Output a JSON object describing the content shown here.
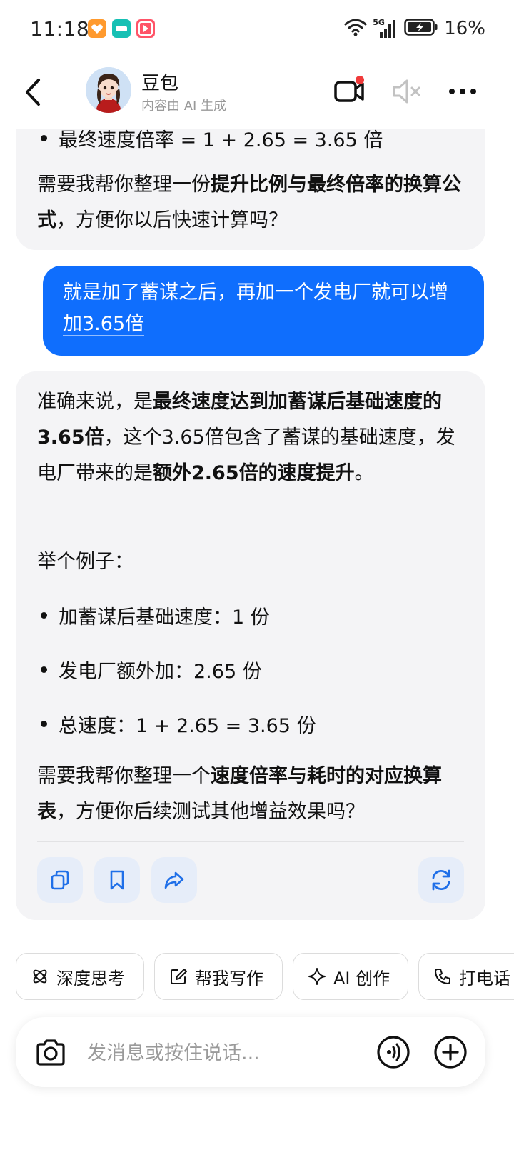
{
  "status": {
    "time": "11:18",
    "network": "5G",
    "battery": "16%"
  },
  "header": {
    "bot_name": "豆包",
    "subtitle": "内容由 AI 生成"
  },
  "messages": {
    "prev_bullet": "最终速度倍率 = 1 + 2.65 = 3.65 倍",
    "prev_question_a": "需要我帮你整理一份",
    "prev_question_b": "提升比例与最终倍率的换算公式",
    "prev_question_c": "，方便你以后快速计算吗？",
    "user": "就是加了蓄谋之后，再加一个发电厂就可以增加3.65倍",
    "reply_p1_a": "准确来说，是",
    "reply_p1_b": "最终速度达到加蓄谋后基础速度的3.65倍",
    "reply_p1_c": "，这个3.65倍包含了蓄谋的基础速度，发电厂带来的是",
    "reply_p1_d": "额外2.65倍的速度提升",
    "reply_p1_e": "。",
    "reply_example": "举个例子：",
    "reply_bullets": [
      "加蓄谋后基础速度：1 份",
      "发电厂额外加：2.65 份",
      "总速度：1 + 2.65 = 3.65 份"
    ],
    "reply_q_a": "需要我帮你整理一个",
    "reply_q_b": "速度倍率与耗时的对应换算表",
    "reply_q_c": "，方便你后续测试其他增益效果吗？"
  },
  "chips": [
    "深度思考",
    "帮我写作",
    "AI 创作",
    "打电话"
  ],
  "input": {
    "placeholder": "发消息或按住说话..."
  },
  "colors": {
    "accent": "#0f6efd",
    "bubble_ai": "#f4f4f6",
    "action_bg": "#e6edf9",
    "notify_dot": "#f03a3a"
  }
}
